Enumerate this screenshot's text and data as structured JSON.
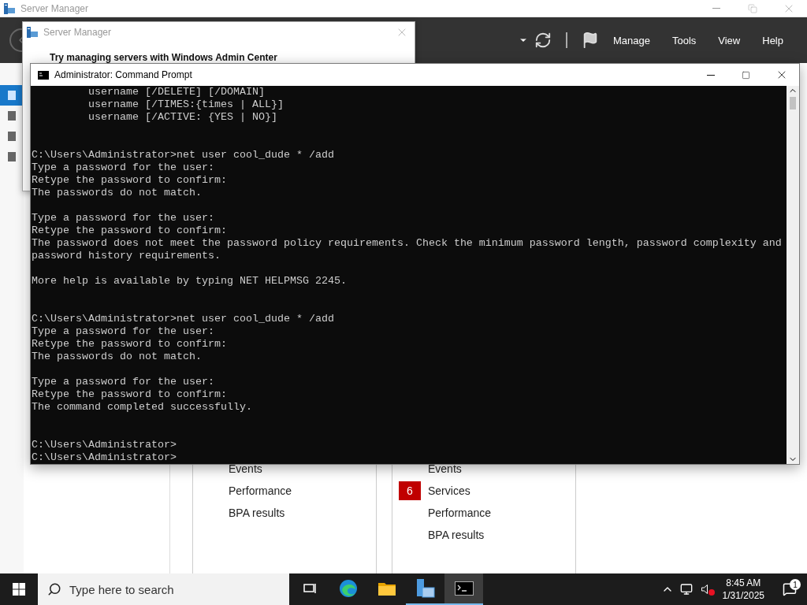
{
  "server_manager": {
    "title": "Server Manager",
    "menu": [
      "Manage",
      "Tools",
      "View",
      "Help"
    ],
    "nav": [
      {
        "selected": true
      },
      {
        "selected": false
      },
      {
        "selected": false
      },
      {
        "selected": false
      }
    ],
    "tiles": [
      {
        "items": [
          {
            "label": "Events"
          },
          {
            "label": "Performance"
          },
          {
            "label": "BPA results"
          }
        ]
      },
      {
        "items": [
          {
            "label": "Events"
          },
          {
            "label": "Services",
            "badge": "6"
          },
          {
            "label": "Performance"
          },
          {
            "label": "BPA results"
          }
        ]
      }
    ]
  },
  "dialog": {
    "title": "Server Manager",
    "heading": "Try managing servers with Windows Admin Center"
  },
  "console": {
    "title": "Administrator: Command Prompt",
    "blocks": [
      {
        "kind": "continuation",
        "lines": [
          "         username [/DELETE] [/DOMAIN]",
          "         username [/TIMES:{times | ALL}]",
          "         username [/ACTIVE: {YES | NO}]"
        ]
      },
      {
        "kind": "prompt",
        "lines": [
          "C:\\Users\\Administrator>net user cool_dude * /add",
          "Type a password for the user:",
          "Retype the password to confirm:",
          "The passwords do not match."
        ]
      },
      {
        "kind": "message",
        "lines": [
          "Type a password for the user:",
          "Retype the password to confirm:",
          "The password does not meet the password policy requirements. Check the minimum password length, password complexity and",
          "password history requirements."
        ]
      },
      {
        "kind": "message",
        "lines": [
          "More help is available by typing NET HELPMSG 2245."
        ]
      },
      {
        "kind": "prompt",
        "lines": [
          "C:\\Users\\Administrator>net user cool_dude * /add",
          "Type a password for the user:",
          "Retype the password to confirm:",
          "The passwords do not match."
        ]
      },
      {
        "kind": "message",
        "lines": [
          "Type a password for the user:",
          "Retype the password to confirm:",
          "The command completed successfully."
        ]
      },
      {
        "kind": "prompt",
        "lines": [
          "C:\\Users\\Administrator>",
          "C:\\Users\\Administrator>"
        ]
      }
    ]
  },
  "taskbar": {
    "search": {
      "placeholder": "Type here to search"
    },
    "apps": [
      {
        "kind": "task-view",
        "running": false,
        "selected": false
      },
      {
        "kind": "edge",
        "running": false,
        "selected": false
      },
      {
        "kind": "explorer",
        "running": false,
        "selected": false
      },
      {
        "kind": "server-manager",
        "running": true,
        "selected": false
      },
      {
        "kind": "terminal",
        "running": true,
        "selected": true
      }
    ],
    "volume_muted": true,
    "time": "8:45 AM",
    "date": "1/31/2025",
    "notifications": "1"
  }
}
